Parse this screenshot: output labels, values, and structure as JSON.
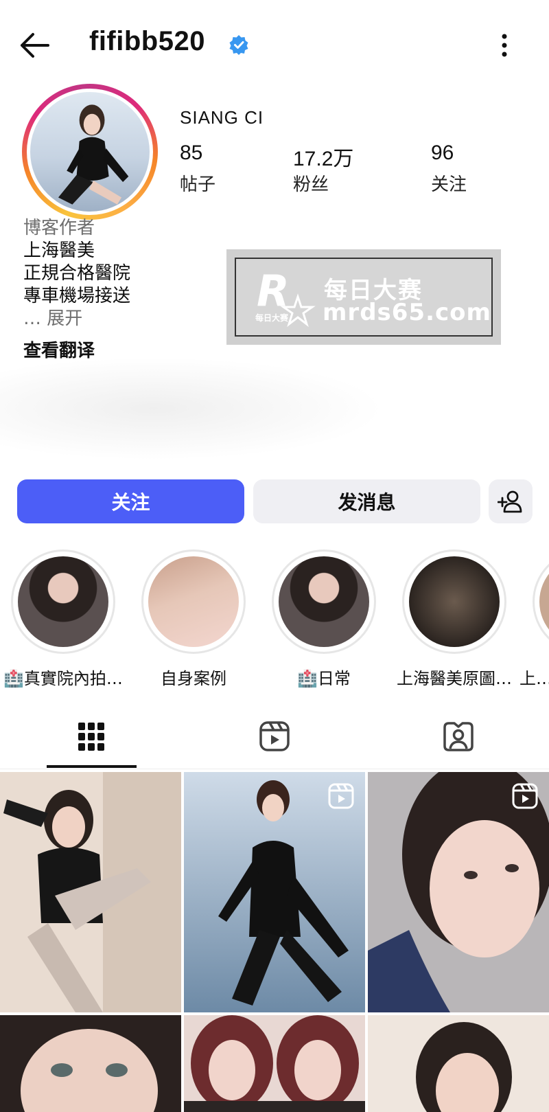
{
  "header": {
    "username": "fifibb520",
    "verified": true,
    "back_icon": "arrow-left-icon",
    "more_icon": "more-vertical-icon"
  },
  "profile": {
    "full_name": "SIANG CI",
    "stats": [
      {
        "value": "85",
        "label": "帖子"
      },
      {
        "value": "17.2万",
        "label": "粉丝"
      },
      {
        "value": "96",
        "label": "关注"
      }
    ],
    "bio": {
      "category": "博客作者",
      "lines": [
        "上海醫美",
        "正規合格醫院",
        "專車機場接送"
      ],
      "more": "… 展开",
      "translate": "查看翻译"
    }
  },
  "watermark": {
    "cn": "每日大赛",
    "url": "mrds65.com",
    "logo_letter": "R",
    "logo_small": "每日大赛"
  },
  "actions": {
    "follow": "关注",
    "message": "发消息",
    "add_user_icon": "person-add-icon"
  },
  "highlights": [
    {
      "label": "🏥真實院內拍…"
    },
    {
      "label": "自身案例"
    },
    {
      "label": "🏥日常"
    },
    {
      "label": "上海醫美原圖…"
    },
    {
      "label": "上…"
    }
  ],
  "tabs": [
    {
      "icon": "grid-icon",
      "active": true
    },
    {
      "icon": "reels-icon",
      "active": false
    },
    {
      "icon": "tagged-icon",
      "active": false
    }
  ],
  "colors": {
    "follow_button": "#4c5ef7",
    "secondary_button": "#efeff3",
    "verified_badge": "#3897f0"
  }
}
